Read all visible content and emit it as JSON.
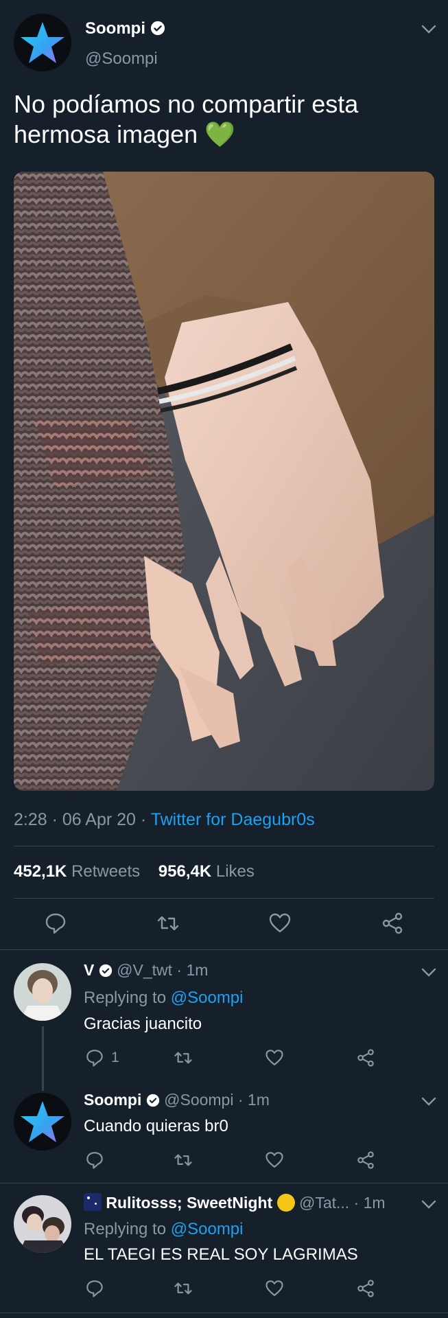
{
  "main": {
    "name": "Soompi",
    "handle": "@Soompi",
    "text": "No podíamos no compartir esta hermosa imagen 💚",
    "time": "2:28",
    "date": "06 Apr 20",
    "source": "Twitter for Daegubr0s",
    "retweets_count": "452,1K",
    "retweets_label": "Retweets",
    "likes_count": "956,4K",
    "likes_label": "Likes",
    "photo_icon": "photo-hands-knit-sweater"
  },
  "replies": [
    {
      "name": "V",
      "handle": "@V_twt",
      "time": "1m",
      "replying_prefix": "Replying to",
      "replying_to": "@Soompi",
      "text": "Gracias juancito",
      "reply_count": "1"
    },
    {
      "name": "Soompi",
      "handle": "@Soompi",
      "time": "1m",
      "text": "Cuando quieras br0"
    },
    {
      "name": "Rulitosss; SweetNight",
      "handle": "@Tat...",
      "time": "1m",
      "replying_prefix": "Replying to",
      "replying_to": "@Soompi",
      "text": "EL TAEGI ES REAL SOY LAGRIMAS"
    }
  ],
  "colors": {
    "background": "#15202b",
    "accent": "#1da1f2",
    "muted": "#8899a6",
    "divider": "#38444d"
  },
  "icons": [
    "star-avatar-icon",
    "verified-icon",
    "chevron-down-icon",
    "reply-icon",
    "retweet-icon",
    "like-icon",
    "share-icon",
    "heart-emoji",
    "moon-emoji"
  ]
}
